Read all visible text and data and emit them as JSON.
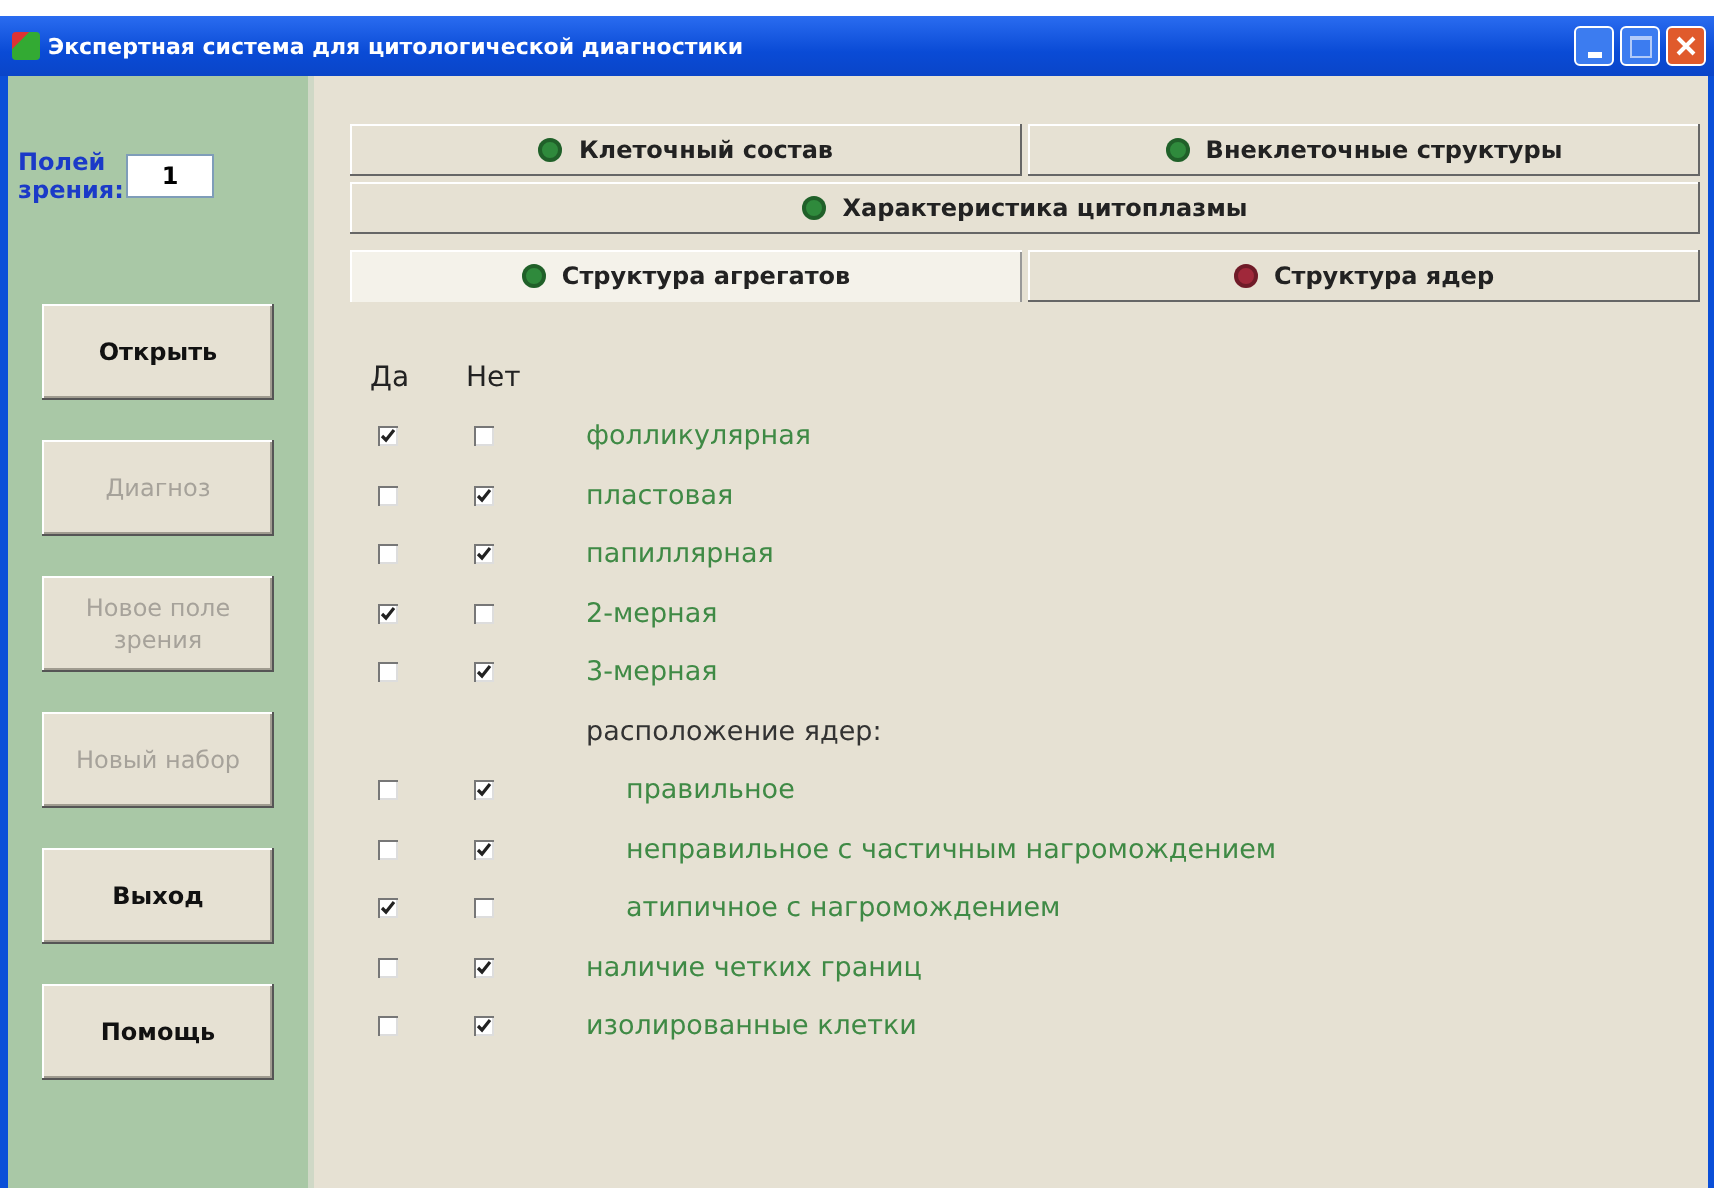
{
  "window": {
    "title": "Экспертная система для цитологической диагностики"
  },
  "sidebar": {
    "fields_label": "Полей зрения:",
    "fields_value": "1",
    "buttons": [
      {
        "label": "Открыть",
        "disabled": false
      },
      {
        "label": "Диагноз",
        "disabled": true
      },
      {
        "label": "Новое поле зрения",
        "disabled": true
      },
      {
        "label": "Новый набор",
        "disabled": true
      },
      {
        "label": "Выход",
        "disabled": false
      },
      {
        "label": "Помощь",
        "disabled": false
      }
    ]
  },
  "tab_rows": [
    [
      {
        "label": "Клеточный состав",
        "selected": false,
        "color": "#2f8a3c"
      },
      {
        "label": "Внеклеточные структуры",
        "selected": false,
        "color": "#2f8a3c"
      }
    ],
    [
      {
        "label": "Характеристика цитоплазмы",
        "selected": false,
        "color": "#2f8a3c"
      }
    ],
    [
      {
        "label": "Структура агрегатов",
        "selected": true,
        "color": "#2f8a3c"
      },
      {
        "label": "Структура ядер",
        "selected": false,
        "color": "#a0283a"
      }
    ]
  ],
  "columns": [
    "Да",
    "Нет"
  ],
  "rows": [
    {
      "kind": "option",
      "label": "фолликулярная",
      "yes": true,
      "no": false
    },
    {
      "kind": "option",
      "label": "пластовая",
      "yes": false,
      "no": true
    },
    {
      "kind": "option",
      "label": "папиллярная",
      "yes": false,
      "no": true
    },
    {
      "kind": "option",
      "label": "2-мерная",
      "yes": true,
      "no": false
    },
    {
      "kind": "option",
      "label": "3-мерная",
      "yes": false,
      "no": true
    },
    {
      "kind": "group",
      "label": "расположение ядер:",
      "children": [
        {
          "kind": "option",
          "label": "правильное",
          "yes": false,
          "no": true
        },
        {
          "kind": "option",
          "label": "неправильное с частичным нагромождением",
          "yes": false,
          "no": true
        },
        {
          "kind": "option",
          "label": "атипичное с нагромождением",
          "yes": true,
          "no": false
        }
      ]
    },
    {
      "kind": "option",
      "label": "наличие четких границ",
      "yes": false,
      "no": true
    },
    {
      "kind": "option",
      "label": "изолированные клетки",
      "yes": false,
      "no": true
    }
  ]
}
